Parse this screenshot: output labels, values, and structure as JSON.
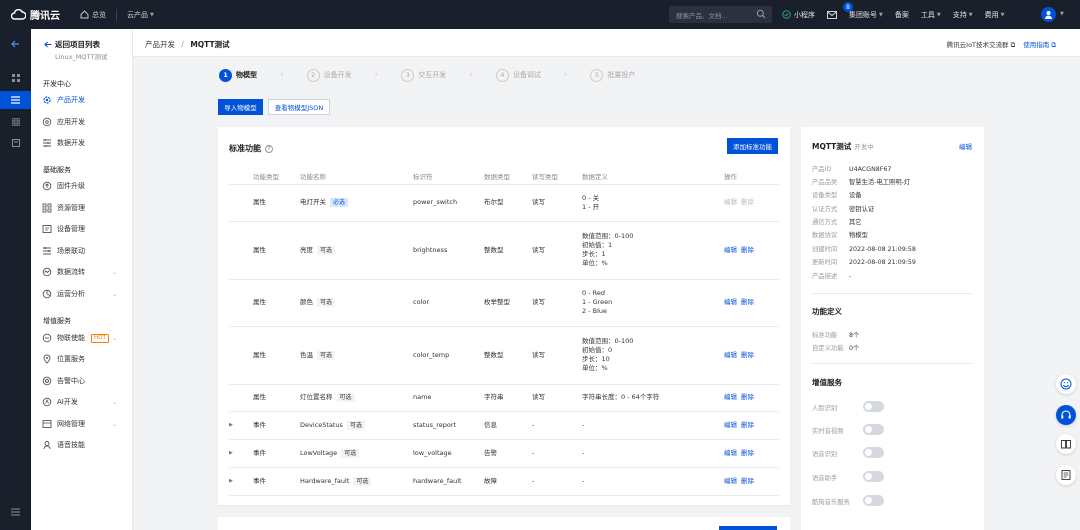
{
  "topbar": {
    "brand": "腾讯云",
    "overview": "总览",
    "products": "云产品",
    "search_placeholder": "搜索产品、文档...",
    "mini_program": "小程序",
    "message_count": "8",
    "group_account": "集团账号",
    "billing": "备案",
    "tools": "工具",
    "support": "支持",
    "costs": "费用"
  },
  "sidebar": {
    "back_label": "返回项目列表",
    "project_name": "Linux_MQTT测试",
    "groups": [
      {
        "title": "开发中心",
        "items": [
          "产品开发",
          "应用开发",
          "数据开发"
        ]
      },
      {
        "title": "基础服务",
        "items": [
          "固件升级",
          "资源管理",
          "设备管理",
          "场景联动",
          "数据流转",
          "运营分析"
        ]
      },
      {
        "title": "增值服务",
        "items": [
          "物联使能",
          "位置服务",
          "告警中心",
          "AI开发",
          "网络管理",
          "语音技能"
        ]
      }
    ],
    "hot_badge": "HOT"
  },
  "header": {
    "breadcrumb_root": "产品开发",
    "breadcrumb_sep": "/",
    "breadcrumb_current": "MQTT测试",
    "link_community": "腾讯云IoT技术交流群",
    "link_guide": "使用指南"
  },
  "steps": [
    {
      "num": "1",
      "label": "物模型"
    },
    {
      "num": "2",
      "label": "设备开发"
    },
    {
      "num": "3",
      "label": "交互开发"
    },
    {
      "num": "4",
      "label": "设备调试"
    },
    {
      "num": "5",
      "label": "批量投产"
    }
  ],
  "actions": {
    "import_model": "导入物模型",
    "view_json": "查看物模型JSON"
  },
  "standard": {
    "title": "标准功能",
    "add_button": "添加标准功能",
    "columns": [
      "功能类型",
      "功能名称",
      "标识符",
      "数据类型",
      "读写类型",
      "数据定义",
      "操作"
    ],
    "edit": "编辑",
    "delete": "删除",
    "tag_required": "必选",
    "tag_optional": "可选",
    "rows": [
      {
        "type": "属性",
        "name": "电灯开关",
        "tag": "必选",
        "id": "power_switch",
        "dtype": "布尔型",
        "rw": "读写",
        "def": [
          "0 - 关",
          "1 - 开"
        ],
        "expand": false,
        "disabled_ops": true
      },
      {
        "type": "属性",
        "name": "亮度",
        "tag": "可选",
        "id": "brightness",
        "dtype": "整数型",
        "rw": "读写",
        "def": [
          "数值范围：0-100",
          "初始值：1",
          "步长：1",
          "单位：%"
        ],
        "expand": false,
        "disabled_ops": false
      },
      {
        "type": "属性",
        "name": "颜色",
        "tag": "可选",
        "id": "color",
        "dtype": "枚举整型",
        "rw": "读写",
        "def": [
          "0 - Red",
          "1 - Green",
          "2 - Blue"
        ],
        "expand": false,
        "disabled_ops": false
      },
      {
        "type": "属性",
        "name": "色温",
        "tag": "可选",
        "id": "color_temp",
        "dtype": "整数型",
        "rw": "读写",
        "def": [
          "数值范围：0-100",
          "初始值：0",
          "步长：10",
          "单位：%"
        ],
        "expand": false,
        "disabled_ops": false
      },
      {
        "type": "属性",
        "name": "灯位置名称",
        "tag": "可选",
        "id": "name",
        "dtype": "字符串",
        "rw": "读写",
        "def": [
          "字符串长度：0 - 64个字符"
        ],
        "expand": false,
        "disabled_ops": false
      },
      {
        "type": "事件",
        "name": "DeviceStatus",
        "tag": "可选",
        "id": "status_report",
        "dtype": "信息",
        "rw": "-",
        "def": [
          "-"
        ],
        "expand": true,
        "disabled_ops": false
      },
      {
        "type": "事件",
        "name": "LowVoltage",
        "tag": "可选",
        "id": "low_voltage",
        "dtype": "告警",
        "rw": "-",
        "def": [
          "-"
        ],
        "expand": true,
        "disabled_ops": false
      },
      {
        "type": "事件",
        "name": "Hardware_fault",
        "tag": "可选",
        "id": "hardware_fault",
        "dtype": "故障",
        "rw": "-",
        "def": [
          "-"
        ],
        "expand": true,
        "disabled_ops": false
      }
    ]
  },
  "product_info": {
    "title": "MQTT测试",
    "status": "开发中",
    "edit": "编辑",
    "fields": [
      {
        "k": "产品ID",
        "v": "U4ACGN8F67"
      },
      {
        "k": "产品品类",
        "v": "智慧生活-电工照明-灯"
      },
      {
        "k": "设备类型",
        "v": "设备"
      },
      {
        "k": "认证方式",
        "v": "密钥认证"
      },
      {
        "k": "通信方式",
        "v": "其它"
      },
      {
        "k": "数据协议",
        "v": "物模型"
      },
      {
        "k": "创建时间",
        "v": "2022-08-08 21:09:58"
      },
      {
        "k": "更新时间",
        "v": "2022-08-08 21:09:59"
      },
      {
        "k": "产品描述",
        "v": "-"
      }
    ],
    "func_title": "功能定义",
    "func_fields": [
      {
        "k": "标准功能",
        "v": "8个"
      },
      {
        "k": "自定义功能",
        "v": "0个"
      }
    ],
    "vas_title": "增值服务",
    "vas_items": [
      "人脸识别",
      "实时音视频",
      "语音识别",
      "语音助手",
      "酷狗音乐服务"
    ]
  },
  "colors": {
    "brand": "#0052d9",
    "topbar_bg": "#191f2b",
    "hot": "#ff7d00"
  }
}
